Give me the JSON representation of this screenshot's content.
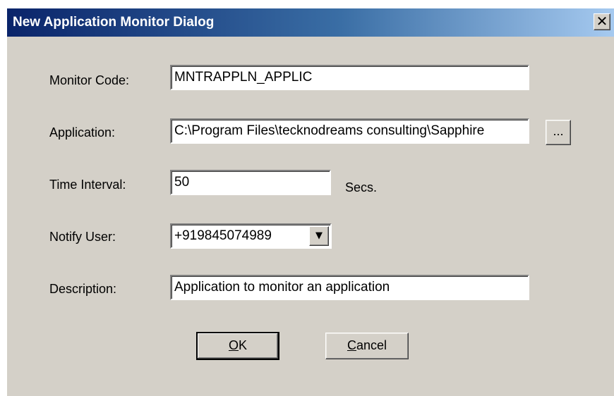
{
  "window": {
    "title": "New Application Monitor Dialog",
    "close_glyph": "✕"
  },
  "form": {
    "monitor_code": {
      "label": "Monitor Code:",
      "value": "MNTRAPPLN_APPLIC"
    },
    "application": {
      "label": "Application:",
      "value": "C:\\Program Files\\tecknodreams consulting\\Sapphire",
      "browse_label": "..."
    },
    "time_interval": {
      "label": "Time Interval:",
      "value": "50",
      "unit": "Secs."
    },
    "notify_user": {
      "label": "Notify User:",
      "value": "+919845074989",
      "arrow_glyph": "▼"
    },
    "description": {
      "label": "Description:",
      "value": "Application to monitor an application"
    }
  },
  "buttons": {
    "ok": {
      "mnemonic": "O",
      "rest": "K"
    },
    "cancel": {
      "mnemonic": "C",
      "rest": "ancel"
    }
  },
  "colors": {
    "titlebar_start": "#0a246a",
    "titlebar_end": "#a6caf0",
    "dialog_bg": "#d4d0c8"
  }
}
